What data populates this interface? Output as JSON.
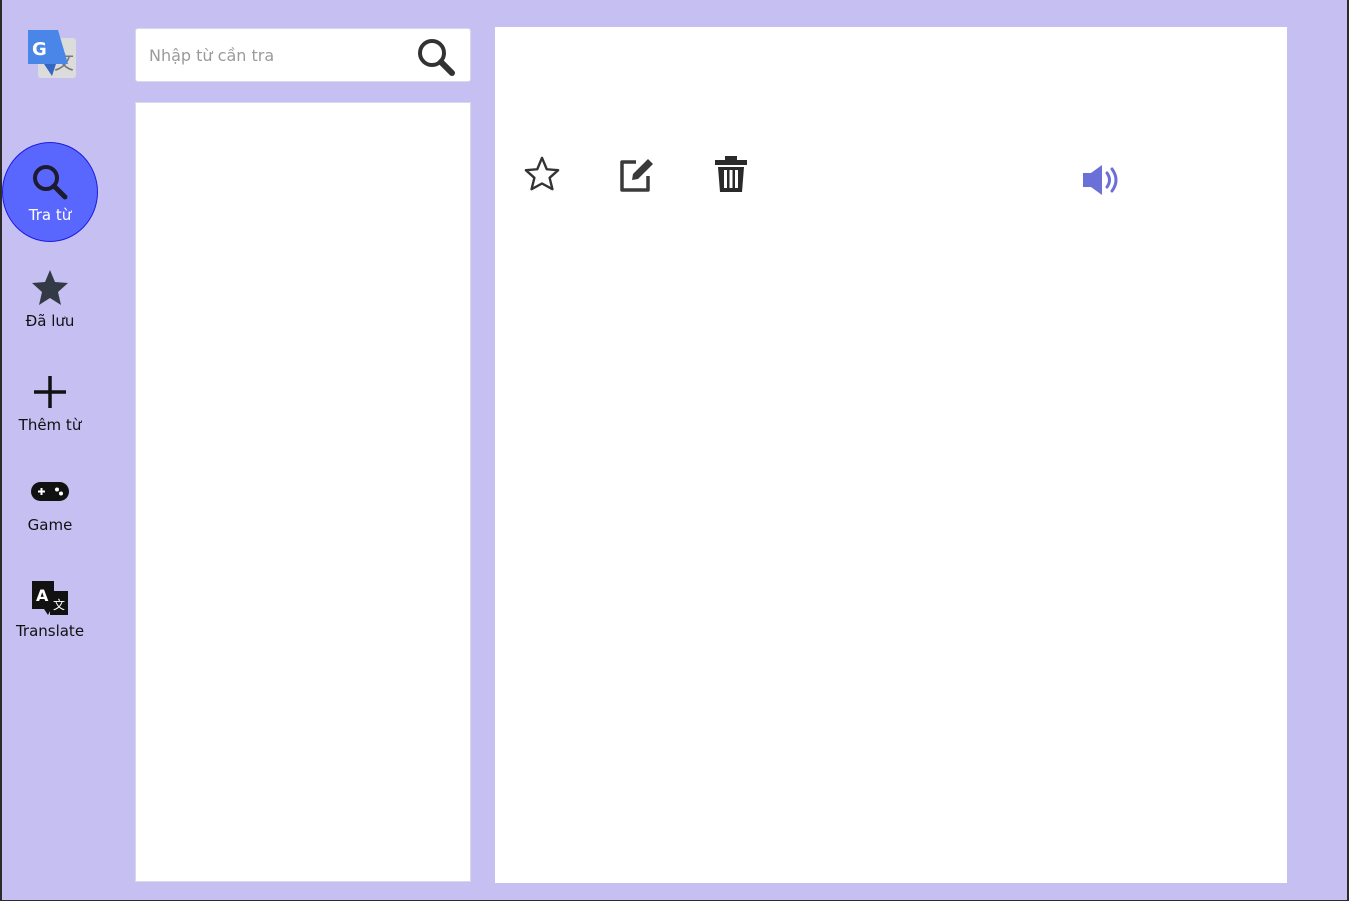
{
  "app": {
    "logo_icon": "google-translate-logo-icon"
  },
  "sidebar": {
    "active_color": "#5a67ff",
    "items": [
      {
        "id": "lookup",
        "label": "Tra từ",
        "icon": "search-icon",
        "active": true
      },
      {
        "id": "saved",
        "label": "Đã lưu",
        "icon": "star-icon",
        "active": false
      },
      {
        "id": "add",
        "label": "Thêm từ",
        "icon": "plus-icon",
        "active": false
      },
      {
        "id": "game",
        "label": "Game",
        "icon": "gamepad-icon",
        "active": false
      },
      {
        "id": "translate",
        "label": "Translate",
        "icon": "translate-icon",
        "active": false
      }
    ]
  },
  "search": {
    "placeholder": "Nhập từ cần tra",
    "value": "",
    "icon": "magnifier-icon"
  },
  "word_list": {
    "items": []
  },
  "definition": {
    "toolbar": [
      {
        "id": "favorite",
        "icon": "star-outline-icon"
      },
      {
        "id": "edit",
        "icon": "edit-icon"
      },
      {
        "id": "delete",
        "icon": "trash-icon"
      },
      {
        "id": "speak",
        "icon": "speaker-icon",
        "color": "#6b6fd8"
      }
    ],
    "content": ""
  },
  "colors": {
    "background": "#c6bff2",
    "panel": "#ffffff"
  }
}
